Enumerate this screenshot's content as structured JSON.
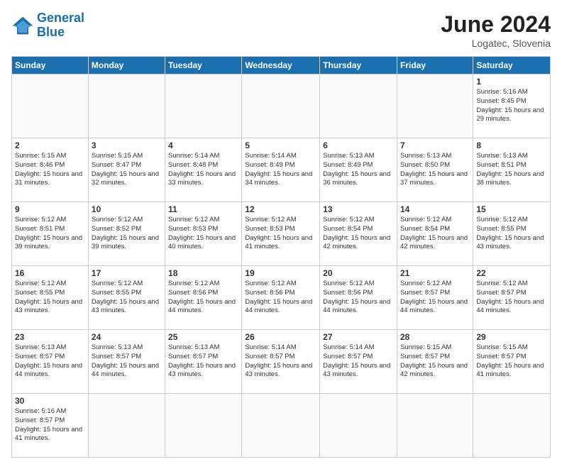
{
  "header": {
    "logo_general": "General",
    "logo_blue": "Blue",
    "month_year": "June 2024",
    "location": "Logatec, Slovenia"
  },
  "weekdays": [
    "Sunday",
    "Monday",
    "Tuesday",
    "Wednesday",
    "Thursday",
    "Friday",
    "Saturday"
  ],
  "days": [
    {
      "num": "",
      "sunrise": "",
      "sunset": "",
      "daylight": ""
    },
    {
      "num": "",
      "sunrise": "",
      "sunset": "",
      "daylight": ""
    },
    {
      "num": "",
      "sunrise": "",
      "sunset": "",
      "daylight": ""
    },
    {
      "num": "",
      "sunrise": "",
      "sunset": "",
      "daylight": ""
    },
    {
      "num": "",
      "sunrise": "",
      "sunset": "",
      "daylight": ""
    },
    {
      "num": "",
      "sunrise": "",
      "sunset": "",
      "daylight": ""
    },
    {
      "num": "1",
      "sunrise": "Sunrise: 5:16 AM",
      "sunset": "Sunset: 8:45 PM",
      "daylight": "Daylight: 15 hours and 29 minutes."
    },
    {
      "num": "2",
      "sunrise": "Sunrise: 5:15 AM",
      "sunset": "Sunset: 8:46 PM",
      "daylight": "Daylight: 15 hours and 31 minutes."
    },
    {
      "num": "3",
      "sunrise": "Sunrise: 5:15 AM",
      "sunset": "Sunset: 8:47 PM",
      "daylight": "Daylight: 15 hours and 32 minutes."
    },
    {
      "num": "4",
      "sunrise": "Sunrise: 5:14 AM",
      "sunset": "Sunset: 8:48 PM",
      "daylight": "Daylight: 15 hours and 33 minutes."
    },
    {
      "num": "5",
      "sunrise": "Sunrise: 5:14 AM",
      "sunset": "Sunset: 8:49 PM",
      "daylight": "Daylight: 15 hours and 34 minutes."
    },
    {
      "num": "6",
      "sunrise": "Sunrise: 5:13 AM",
      "sunset": "Sunset: 8:49 PM",
      "daylight": "Daylight: 15 hours and 36 minutes."
    },
    {
      "num": "7",
      "sunrise": "Sunrise: 5:13 AM",
      "sunset": "Sunset: 8:50 PM",
      "daylight": "Daylight: 15 hours and 37 minutes."
    },
    {
      "num": "8",
      "sunrise": "Sunrise: 5:13 AM",
      "sunset": "Sunset: 8:51 PM",
      "daylight": "Daylight: 15 hours and 38 minutes."
    },
    {
      "num": "9",
      "sunrise": "Sunrise: 5:12 AM",
      "sunset": "Sunset: 8:51 PM",
      "daylight": "Daylight: 15 hours and 39 minutes."
    },
    {
      "num": "10",
      "sunrise": "Sunrise: 5:12 AM",
      "sunset": "Sunset: 8:52 PM",
      "daylight": "Daylight: 15 hours and 39 minutes."
    },
    {
      "num": "11",
      "sunrise": "Sunrise: 5:12 AM",
      "sunset": "Sunset: 8:53 PM",
      "daylight": "Daylight: 15 hours and 40 minutes."
    },
    {
      "num": "12",
      "sunrise": "Sunrise: 5:12 AM",
      "sunset": "Sunset: 8:53 PM",
      "daylight": "Daylight: 15 hours and 41 minutes."
    },
    {
      "num": "13",
      "sunrise": "Sunrise: 5:12 AM",
      "sunset": "Sunset: 8:54 PM",
      "daylight": "Daylight: 15 hours and 42 minutes."
    },
    {
      "num": "14",
      "sunrise": "Sunrise: 5:12 AM",
      "sunset": "Sunset: 8:54 PM",
      "daylight": "Daylight: 15 hours and 42 minutes."
    },
    {
      "num": "15",
      "sunrise": "Sunrise: 5:12 AM",
      "sunset": "Sunset: 8:55 PM",
      "daylight": "Daylight: 15 hours and 43 minutes."
    },
    {
      "num": "16",
      "sunrise": "Sunrise: 5:12 AM",
      "sunset": "Sunset: 8:55 PM",
      "daylight": "Daylight: 15 hours and 43 minutes."
    },
    {
      "num": "17",
      "sunrise": "Sunrise: 5:12 AM",
      "sunset": "Sunset: 8:55 PM",
      "daylight": "Daylight: 15 hours and 43 minutes."
    },
    {
      "num": "18",
      "sunrise": "Sunrise: 5:12 AM",
      "sunset": "Sunset: 8:56 PM",
      "daylight": "Daylight: 15 hours and 44 minutes."
    },
    {
      "num": "19",
      "sunrise": "Sunrise: 5:12 AM",
      "sunset": "Sunset: 8:56 PM",
      "daylight": "Daylight: 15 hours and 44 minutes."
    },
    {
      "num": "20",
      "sunrise": "Sunrise: 5:12 AM",
      "sunset": "Sunset: 8:56 PM",
      "daylight": "Daylight: 15 hours and 44 minutes."
    },
    {
      "num": "21",
      "sunrise": "Sunrise: 5:12 AM",
      "sunset": "Sunset: 8:57 PM",
      "daylight": "Daylight: 15 hours and 44 minutes."
    },
    {
      "num": "22",
      "sunrise": "Sunrise: 5:12 AM",
      "sunset": "Sunset: 8:57 PM",
      "daylight": "Daylight: 15 hours and 44 minutes."
    },
    {
      "num": "23",
      "sunrise": "Sunrise: 5:13 AM",
      "sunset": "Sunset: 8:57 PM",
      "daylight": "Daylight: 15 hours and 44 minutes."
    },
    {
      "num": "24",
      "sunrise": "Sunrise: 5:13 AM",
      "sunset": "Sunset: 8:57 PM",
      "daylight": "Daylight: 15 hours and 44 minutes."
    },
    {
      "num": "25",
      "sunrise": "Sunrise: 5:13 AM",
      "sunset": "Sunset: 8:57 PM",
      "daylight": "Daylight: 15 hours and 43 minutes."
    },
    {
      "num": "26",
      "sunrise": "Sunrise: 5:14 AM",
      "sunset": "Sunset: 8:57 PM",
      "daylight": "Daylight: 15 hours and 43 minutes."
    },
    {
      "num": "27",
      "sunrise": "Sunrise: 5:14 AM",
      "sunset": "Sunset: 8:57 PM",
      "daylight": "Daylight: 15 hours and 43 minutes."
    },
    {
      "num": "28",
      "sunrise": "Sunrise: 5:15 AM",
      "sunset": "Sunset: 8:57 PM",
      "daylight": "Daylight: 15 hours and 42 minutes."
    },
    {
      "num": "29",
      "sunrise": "Sunrise: 5:15 AM",
      "sunset": "Sunset: 8:57 PM",
      "daylight": "Daylight: 15 hours and 41 minutes."
    },
    {
      "num": "30",
      "sunrise": "Sunrise: 5:16 AM",
      "sunset": "Sunset: 8:57 PM",
      "daylight": "Daylight: 15 hours and 41 minutes."
    }
  ]
}
